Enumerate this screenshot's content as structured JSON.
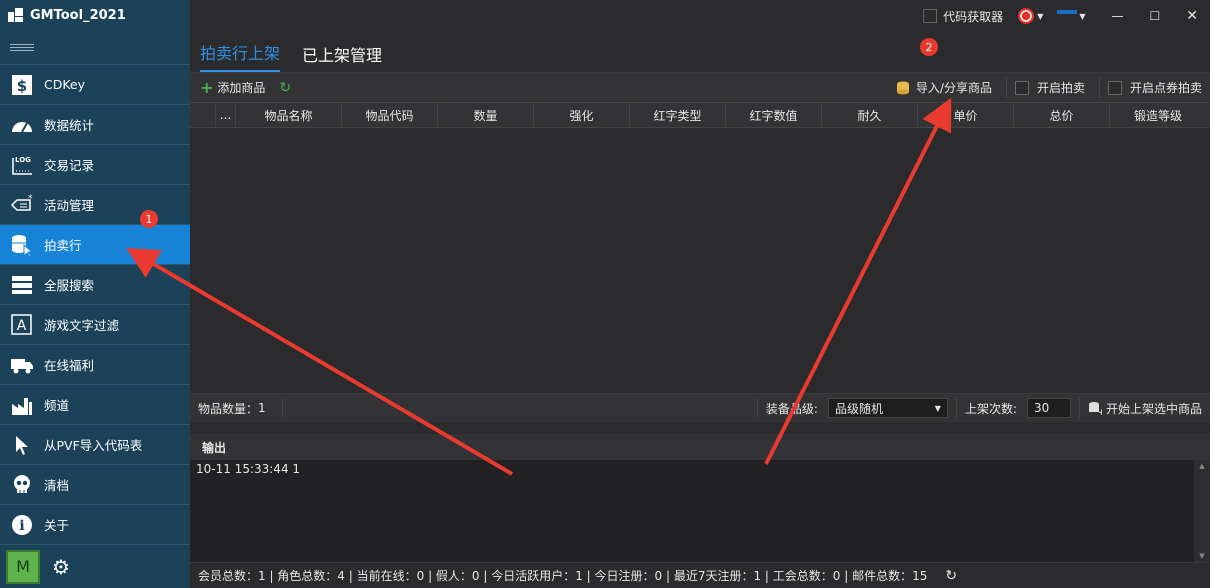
{
  "app": {
    "title": "GMTool_2021"
  },
  "sidebar": {
    "items": [
      {
        "label": "CDKey",
        "icon": "dollar-icon"
      },
      {
        "label": "数据统计",
        "icon": "dashboard-icon"
      },
      {
        "label": "交易记录",
        "icon": "log-icon"
      },
      {
        "label": "活动管理",
        "icon": "ticket-icon"
      },
      {
        "label": "拍卖行",
        "icon": "database-cursor-icon",
        "active": true
      },
      {
        "label": "全服搜索",
        "icon": "server-icon"
      },
      {
        "label": "游戏文字过滤",
        "icon": "text-filter-icon"
      },
      {
        "label": "在线福利",
        "icon": "truck-icon"
      },
      {
        "label": "频道",
        "icon": "factory-icon"
      },
      {
        "label": "从PVF导入代码表",
        "icon": "cursor-icon"
      },
      {
        "label": "清档",
        "icon": "skull-icon"
      },
      {
        "label": "关于",
        "icon": "info-icon"
      }
    ],
    "user_badge": "M"
  },
  "titlebar": {
    "code_fetcher_label": "代码获取器"
  },
  "tabs": [
    {
      "label": "拍卖行上架",
      "active": true
    },
    {
      "label": "已上架管理",
      "active": false
    }
  ],
  "toolbar": {
    "add_label": "添加商品",
    "import_label": "导入/分享商品",
    "open_auction_label": "开启拍卖",
    "open_point_auction_label": "开启点券拍卖"
  },
  "grid": {
    "columns": [
      "...",
      "物品名称",
      "物品代码",
      "数量",
      "强化",
      "红字类型",
      "红字数值",
      "耐久",
      "单价",
      "总价",
      "锻造等级"
    ]
  },
  "status1": {
    "item_count_label": "物品数量：",
    "item_count": "1",
    "grade_label": "装备品级:",
    "grade_value": "品级随机",
    "times_label": "上架次数:",
    "times_value": "30",
    "start_label": "开始上架选中商品"
  },
  "output": {
    "title": "输出",
    "lines": [
      "10-11 15:33:44 1"
    ]
  },
  "bottom": {
    "text": "会员总数：1 | 角色总数：4 | 当前在线：0 | 假人：0 | 今日活跃用户：1 | 今日注册：0 | 最近7天注册：1 | 工会总数：0 | 邮件总数：15"
  },
  "annotations": {
    "badge1": "1",
    "badge2": "2"
  },
  "colors": {
    "sidebar": "#1b4259",
    "active": "#1683d6",
    "accent": "#2f8fe0",
    "arrow": "#e83a2f"
  }
}
